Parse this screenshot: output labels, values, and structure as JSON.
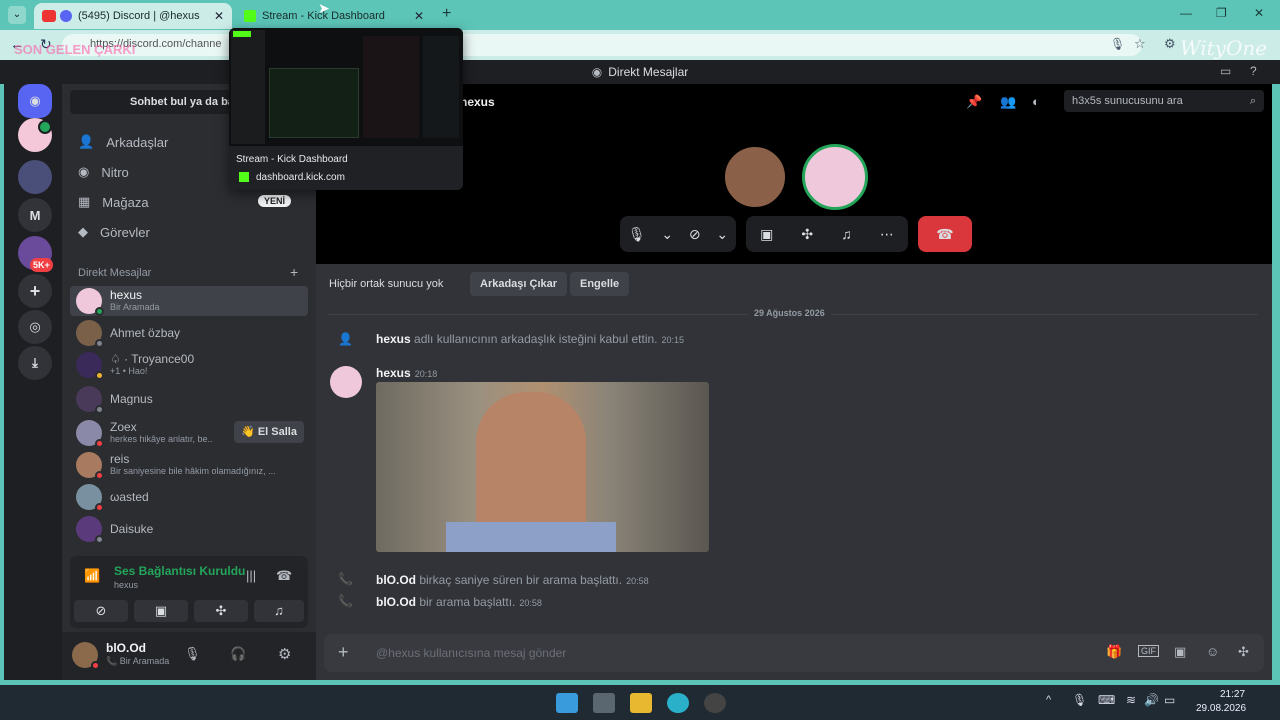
{
  "browser": {
    "tabs": [
      {
        "title": "(5495) Discord | @hexus",
        "active": true
      },
      {
        "title": "Stream - Kick Dashboard",
        "active": false
      }
    ],
    "url": "https://discord.com/channe",
    "overlay_text": "SON GELEN ÇARKI",
    "watermark": "WityOne",
    "hover_preview": {
      "title": "Stream - Kick Dashboard",
      "domain": "dashboard.kick.com"
    }
  },
  "discord": {
    "window_title": "Direkt Mesajlar",
    "servers": {
      "badge_count": "5K+",
      "letter_server": "M"
    },
    "dm_panel": {
      "search_placeholder": "Sohbet bul ya da ba",
      "nav": [
        {
          "label": "Arkadaşlar",
          "icon": "friends-icon"
        },
        {
          "label": "Nitro",
          "icon": "nitro-icon"
        },
        {
          "label": "Mağaza",
          "icon": "shop-icon",
          "badge": "YENİ"
        },
        {
          "label": "Görevler",
          "icon": "quests-icon"
        }
      ],
      "section_title": "Direkt Mesajlar",
      "add_label": "+",
      "dms": [
        {
          "name": "hexus",
          "status": "Bir Aramada",
          "selected": true,
          "dot": "#23a55a"
        },
        {
          "name": "Ahmet özbay",
          "status": "",
          "dot": "#80848e"
        },
        {
          "name": "♤ · Troyance00",
          "status": "+1 • Hao!",
          "dot": "#f0b232"
        },
        {
          "name": "Magnus",
          "status": "",
          "dot": "#80848e"
        },
        {
          "name": "Zoex",
          "status": "herkes hikâye anlatır, be..",
          "dot": "#f23f43",
          "wave_label": "El Salla"
        },
        {
          "name": "reis",
          "status": "Bir saniyesine bile hâkim olamadığınız, ...",
          "dot": "#f23f43"
        },
        {
          "name": "ωasted",
          "status": "",
          "dot": "#f23f43"
        },
        {
          "name": "Daisuke",
          "status": "",
          "dot": "#80848e"
        }
      ],
      "voice": {
        "status": "Ses Bağlantısı Kuruldu",
        "channel": "hexus"
      },
      "user": {
        "name": "blO.Od",
        "status": "Bir Aramada"
      }
    },
    "main": {
      "channel_name": "hexus",
      "search_placeholder": "h3x5s sunucusunu ara",
      "profile_bar": {
        "no_servers": "Hiçbir ortak sunucu yok",
        "remove_friend": "Arkadaşı Çıkar",
        "block": "Engelle"
      },
      "date_divider": "29 Ağustos 2026",
      "messages": [
        {
          "type": "system",
          "user": "hexus",
          "text": "adlı kullanıcının arkadaşlık isteğini kabul ettin.",
          "time": "20:15"
        },
        {
          "type": "user",
          "user": "hexus",
          "time": "20:18",
          "image": "gif-attachment"
        },
        {
          "type": "call",
          "user": "blO.Od",
          "text": "birkaç saniye süren bir arama başlattı.",
          "time": "20:58"
        },
        {
          "type": "call",
          "user": "blO.Od",
          "text": "bir arama başlattı.",
          "time": "20:58"
        }
      ],
      "composer_placeholder": "@hexus kullanıcısına mesaj gönder"
    }
  },
  "taskbar": {
    "time": "21:27",
    "date": "29.08.2026"
  },
  "colors": {
    "accent": "#5865f2",
    "teal": "#5cc5b7",
    "green": "#23a55a",
    "red": "#da373c"
  }
}
